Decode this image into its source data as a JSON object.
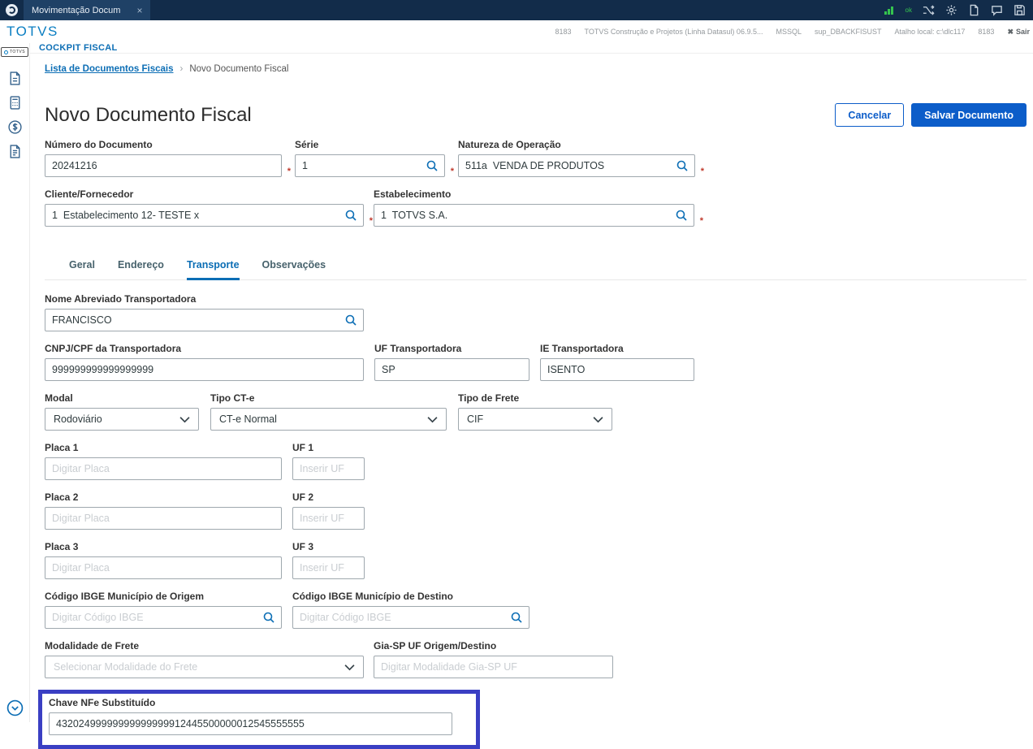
{
  "titlebar": {
    "tab_label": "Movimentação Docum",
    "close_label": "×",
    "connection_status": "ok"
  },
  "header": {
    "logo": "TOTVS",
    "env": [
      "8183",
      "TOTVS Construção e Projetos (Linha Datasul) 06.9.5...",
      "MSSQL",
      "sup_DBACKFISUST",
      "Atalho local: c:\\dlc117",
      "8183"
    ],
    "sair_icon": "✖",
    "sair_label": "Sair"
  },
  "subheader": {
    "title": "COCKPIT FISCAL"
  },
  "breadcrumb": {
    "parent": "Lista de Documentos Fiscais",
    "separator": "›",
    "current": "Novo Documento Fiscal"
  },
  "page": {
    "title": "Novo Documento Fiscal",
    "cancel_label": "Cancelar",
    "save_label": "Salvar Documento"
  },
  "document_fields": {
    "numero": {
      "label": "Número do Documento",
      "value": "20241216"
    },
    "serie": {
      "label": "Série",
      "value": "1"
    },
    "natureza": {
      "label": "Natureza de Operação",
      "value": "511a  VENDA DE PRODUTOS"
    },
    "cliente": {
      "label": "Cliente/Fornecedor",
      "value": "1  Estabelecimento 12- TESTE x"
    },
    "estabelecimento": {
      "label": "Estabelecimento",
      "value": "1  TOTVS S.A."
    }
  },
  "tabs": {
    "geral": "Geral",
    "endereco": "Endereço",
    "transporte": "Transporte",
    "observacoes": "Observações",
    "active": "Transporte"
  },
  "transporte": {
    "nome_abreviado": {
      "label": "Nome Abreviado Transportadora",
      "value": "FRANCISCO"
    },
    "cnpj": {
      "label": "CNPJ/CPF da Transportadora",
      "value": "999999999999999999"
    },
    "uf_transportadora": {
      "label": "UF Transportadora",
      "value": "SP"
    },
    "ie_transportadora": {
      "label": "IE Transportadora",
      "value": "ISENTO"
    },
    "modal": {
      "label": "Modal",
      "value": "Rodoviário"
    },
    "tipo_cte": {
      "label": "Tipo CT-e",
      "value": "CT-e Normal"
    },
    "tipo_frete": {
      "label": "Tipo de Frete",
      "value": "CIF"
    },
    "placa1": {
      "label": "Placa 1",
      "placeholder": "Digitar Placa"
    },
    "uf1": {
      "label": "UF 1",
      "placeholder": "Inserir UF"
    },
    "placa2": {
      "label": "Placa 2",
      "placeholder": "Digitar Placa"
    },
    "uf2": {
      "label": "UF 2",
      "placeholder": "Inserir UF"
    },
    "placa3": {
      "label": "Placa 3",
      "placeholder": "Digitar Placa"
    },
    "uf3": {
      "label": "UF 3",
      "placeholder": "Inserir UF"
    },
    "ibge_origem": {
      "label": "Código IBGE Município de Origem",
      "placeholder": "Digitar Código IBGE"
    },
    "ibge_destino": {
      "label": "Código IBGE Município de Destino",
      "placeholder": "Digitar Código IBGE"
    },
    "modalidade_frete": {
      "label": "Modalidade de Frete",
      "placeholder": "Selecionar Modalidade do Frete"
    },
    "gia_sp": {
      "label": "Gia-SP UF Origem/Destino",
      "placeholder": "Digitar Modalidade Gia-SP UF"
    },
    "chave_nfe": {
      "label": "Chave NFe Substituído",
      "value": "43202499999999999999912445500000012545555555"
    }
  },
  "colors": {
    "titlebar_bg": "#122c4a",
    "accent_blue": "#0c6eb5",
    "primary_button": "#0c5dc9",
    "highlight_border": "#3a3fc3",
    "required_red": "#c0392b",
    "status_green": "#35c44f"
  }
}
